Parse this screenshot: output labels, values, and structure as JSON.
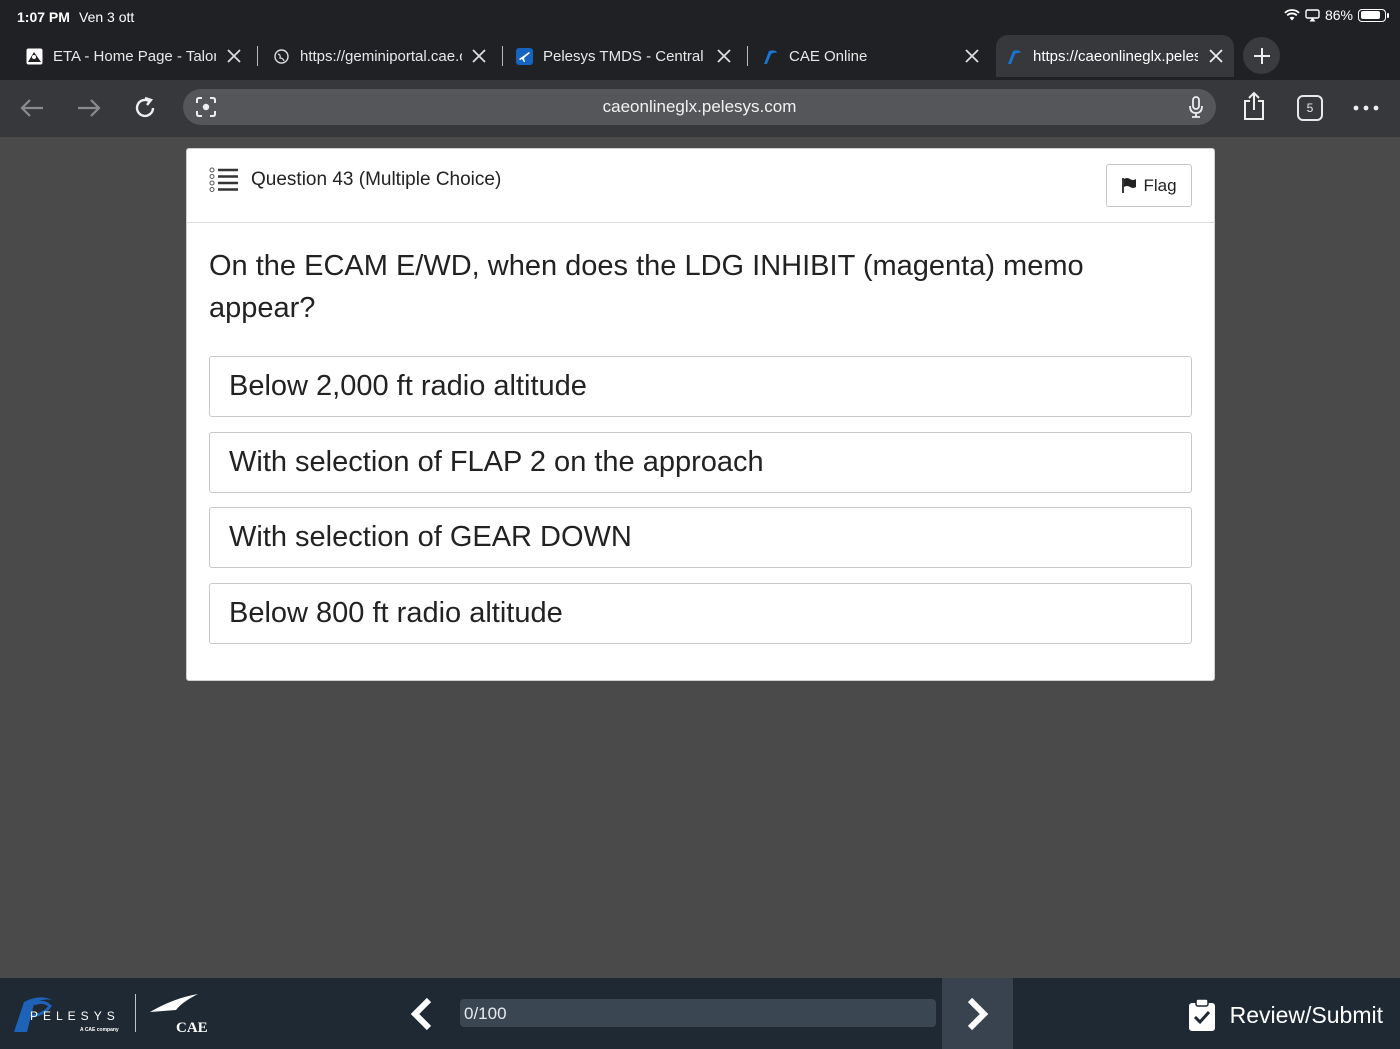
{
  "status_bar": {
    "time": "1:07 PM",
    "date": "Ven 3 ott",
    "battery": "86%",
    "battery_level": 0.86
  },
  "tabs": [
    {
      "title": "ETA - Home Page - Talon",
      "active": false
    },
    {
      "title": "https://geminiportal.cae.com",
      "active": false
    },
    {
      "title": "Pelesys TMDS - Central",
      "active": false
    },
    {
      "title": "CAE Online",
      "active": false
    },
    {
      "title": "https://caeonlineglx.pelesys.com",
      "active": true
    }
  ],
  "address_bar": {
    "url": "caeonlineglx.pelesys.com"
  },
  "tab_count": "5",
  "question": {
    "header": "Question 43 (Multiple Choice)",
    "flag_label": "Flag",
    "text": "On the ECAM E/WD, when does the LDG INHIBIT (magenta) memo appear?",
    "options": [
      "Below 2,000 ft radio altitude",
      "With selection of FLAP 2 on the approach",
      "With selection of GEAR DOWN",
      "Below 800 ft radio altitude"
    ]
  },
  "footer": {
    "pelesys_logo_text": "PELESYS",
    "pelesys_tagline": "A CAE company",
    "cae_logo_text": "CAE",
    "progress_label": "0/100",
    "progress_fraction": 0.0,
    "review_label": "Review/Submit"
  },
  "colors": {
    "chrome_bg": "#202124",
    "toolbar_bg": "#37383b",
    "page_bg": "#4a4a4a",
    "footer_bg": "#1f2933",
    "accent_blue": "#1565c0"
  }
}
